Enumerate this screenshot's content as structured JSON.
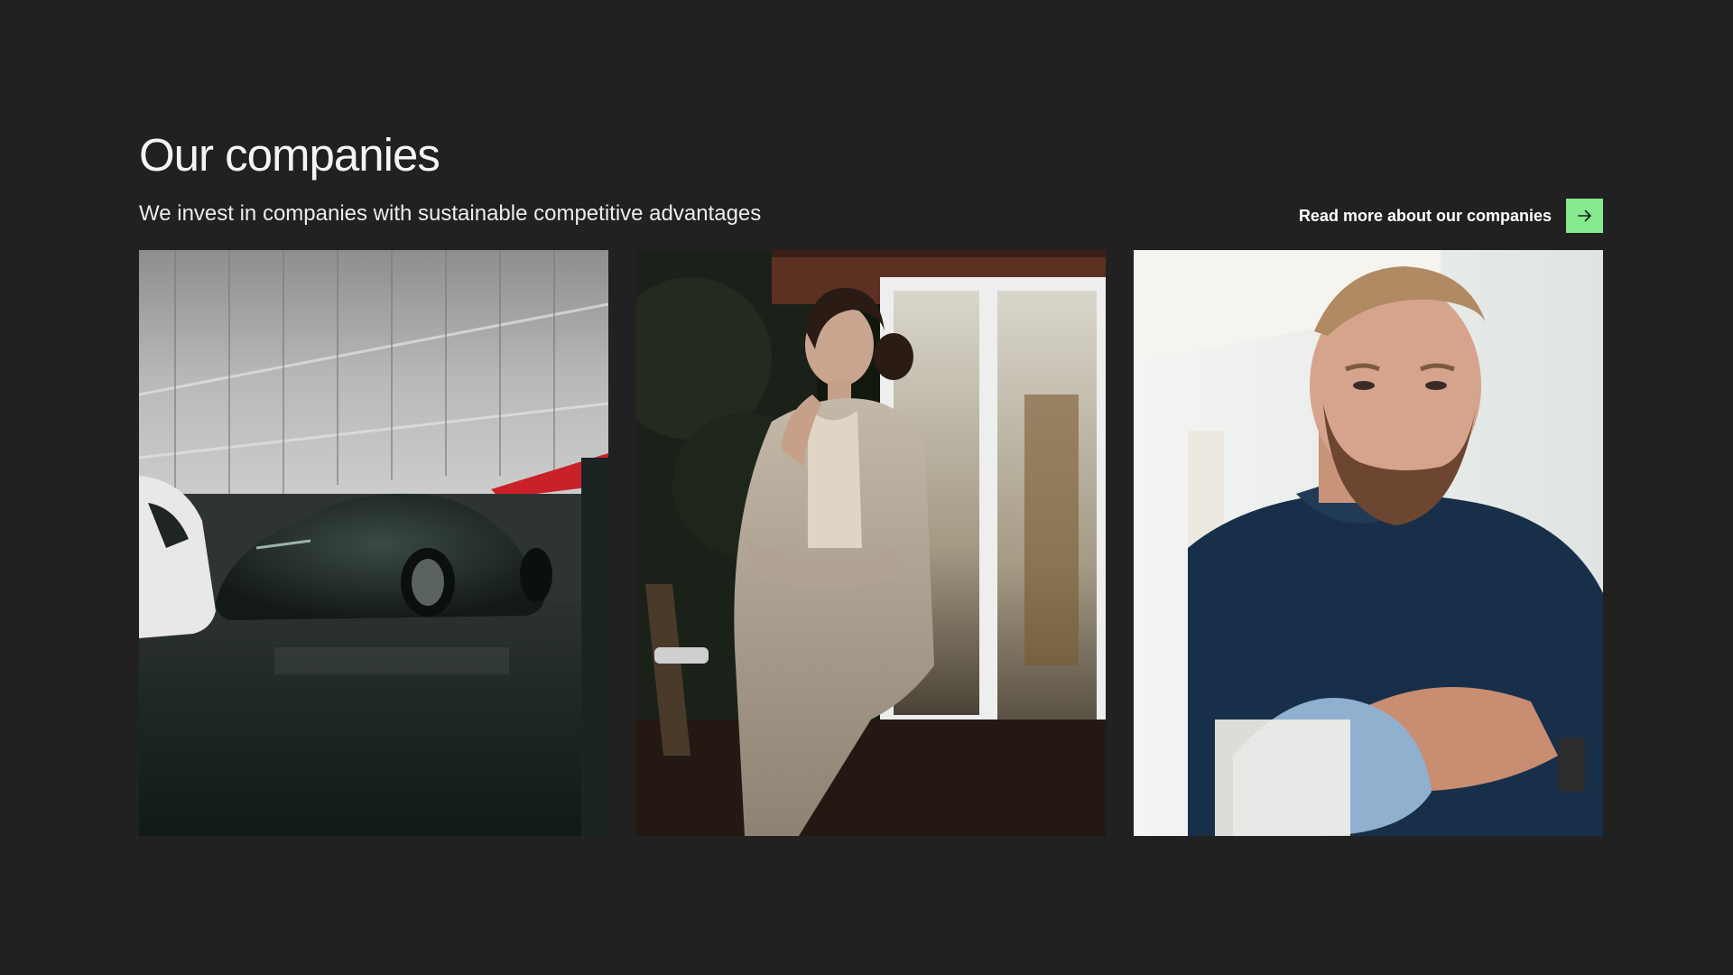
{
  "section": {
    "title": "Our companies",
    "subtitle": "We invest in companies with sustainable competitive advantages",
    "read_more_label": "Read more about our companies",
    "arrow_icon": "arrow-right-icon",
    "accent_color": "#86ea8f",
    "background_color": "#212121"
  },
  "cards": [
    {
      "image": "sports-car-garage-photo"
    },
    {
      "image": "woman-in-cardigan-photo"
    },
    {
      "image": "man-cleaning-photo"
    }
  ]
}
